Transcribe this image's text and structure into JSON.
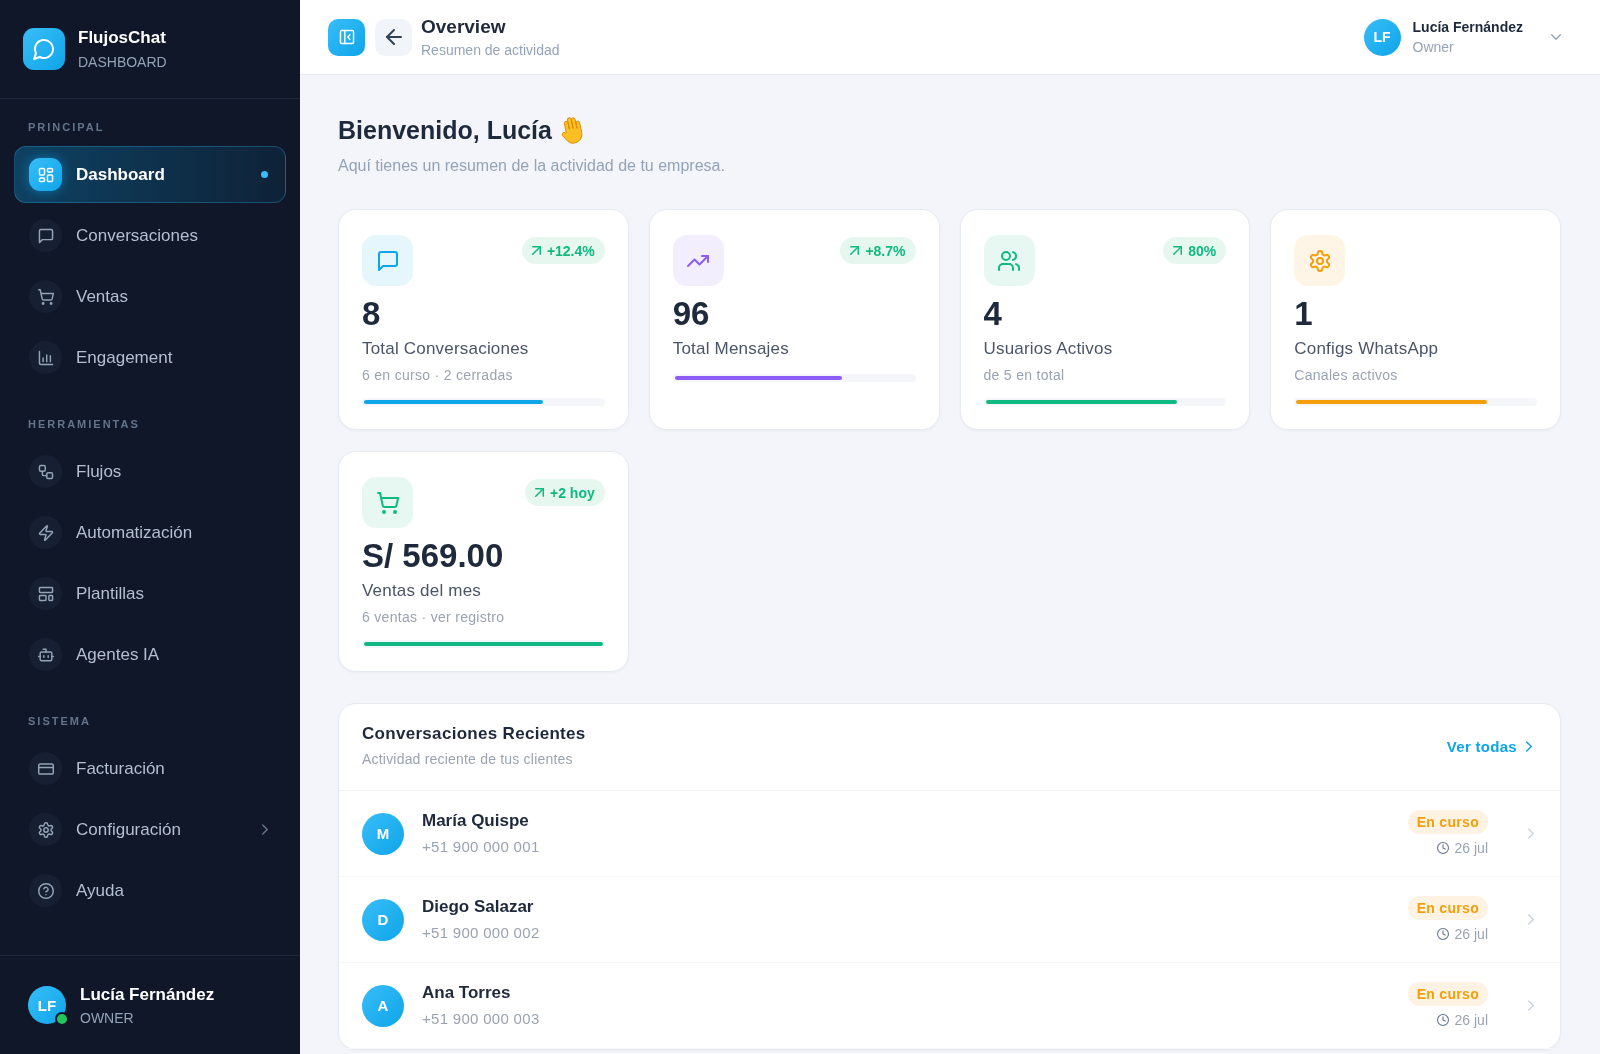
{
  "sidebar": {
    "brand": {
      "name": "FlujosChat",
      "subtitle": "DASHBOARD"
    },
    "sections": [
      {
        "title": "PRINCIPAL",
        "items": [
          {
            "label": "Dashboard",
            "kind": "link",
            "selected": true
          },
          {
            "label": "Conversaciones",
            "kind": "link",
            "selected": false
          },
          {
            "label": "Ventas",
            "kind": "link",
            "selected": false
          },
          {
            "label": "Engagement",
            "kind": "link",
            "selected": false
          }
        ]
      },
      {
        "title": "HERRAMIENTAS",
        "items": [
          {
            "label": "Flujos",
            "kind": "link",
            "selected": false
          },
          {
            "label": "Automatización",
            "kind": "link",
            "selected": false
          },
          {
            "label": "Plantillas",
            "kind": "link",
            "selected": false
          },
          {
            "label": "Agentes IA",
            "kind": "link",
            "selected": false
          }
        ]
      },
      {
        "title": "SISTEMA",
        "items": [
          {
            "label": "Facturación",
            "kind": "link",
            "selected": false
          },
          {
            "label": "Configuración",
            "kind": "submenu",
            "selected": false
          },
          {
            "label": "Ayuda",
            "kind": "link",
            "selected": false
          }
        ]
      }
    ],
    "user": {
      "initials": "LF",
      "name": "Lucía Fernández",
      "role": "OWNER",
      "online": true
    }
  },
  "header": {
    "title": "Overview",
    "subtitle": "Resumen de actividad",
    "user": {
      "initials": "LF",
      "name": "Lucía Fernández",
      "role": "Owner"
    }
  },
  "welcome": {
    "title": "Bienvenido, Lucía",
    "subtitle": "Aquí tienes un resumen de la actividad de tu empresa."
  },
  "stats": [
    {
      "value": "8",
      "label": "Total Conversaciones",
      "detail": "6 en curso · 2 cerradas",
      "trend": "+12.4%",
      "level": 0.75,
      "color": "#0ea5e9"
    },
    {
      "value": "96",
      "label": "Total Mensajes",
      "trend": "+8.7%",
      "level": 0.7,
      "color": "#8b5cf6"
    },
    {
      "value": "4",
      "label": "Usuarios Activos",
      "detail": "de 5 en total",
      "trend": "80%",
      "level": 0.8,
      "color": "#10b981"
    },
    {
      "value": "1",
      "label": "Configs WhatsApp",
      "detail": "Canales activos",
      "level": 0.8,
      "color": "#f59e0b"
    },
    {
      "value": "S/ 569.00",
      "label": "Ventas del mes",
      "detail": "6 ventas · ver registro",
      "trend": "+2 hoy",
      "level": 1,
      "color": "#10b981"
    }
  ],
  "recent_conversations": {
    "title": "Conversaciones Recientes",
    "subtitle": "Actividad reciente de tus clientes",
    "link": "Ver todas",
    "rows": [
      {
        "initial": "M",
        "name": "María Quispe",
        "phone": "+51 900 000 001",
        "status": "En curso",
        "date": "26 jul"
      },
      {
        "initial": "D",
        "name": "Diego Salazar",
        "phone": "+51 900 000 002",
        "status": "En curso",
        "date": "26 jul"
      },
      {
        "initial": "A",
        "name": "Ana Torres",
        "phone": "+51 900 000 003",
        "status": "En curso",
        "date": "26 jul"
      }
    ]
  }
}
